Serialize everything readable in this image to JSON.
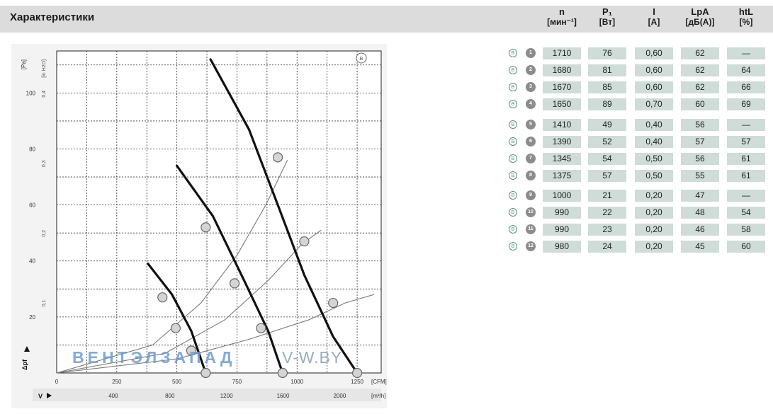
{
  "header": {
    "title": "Характеристики",
    "columns": [
      {
        "symbol": "n",
        "unit": "[мин⁻¹]"
      },
      {
        "symbol": "P₁",
        "unit": "[Вт]"
      },
      {
        "symbol": "I",
        "unit": "[A]"
      },
      {
        "symbol": "LpA",
        "unit": "[дБ(А)]"
      },
      {
        "symbol": "htL",
        "unit": "[%]"
      }
    ]
  },
  "table": {
    "badge_letter": "B",
    "rows": [
      {
        "id": "1",
        "n": "1710",
        "p1": "76",
        "i": "0,60",
        "lpa": "62",
        "htl": "—"
      },
      {
        "id": "2",
        "n": "1680",
        "p1": "81",
        "i": "0,60",
        "lpa": "62",
        "htl": "64"
      },
      {
        "id": "3",
        "n": "1670",
        "p1": "85",
        "i": "0,60",
        "lpa": "62",
        "htl": "66"
      },
      {
        "id": "4",
        "n": "1650",
        "p1": "89",
        "i": "0,70",
        "lpa": "60",
        "htl": "69"
      },
      {
        "id": "5",
        "n": "1410",
        "p1": "49",
        "i": "0,40",
        "lpa": "56",
        "htl": "—"
      },
      {
        "id": "6",
        "n": "1390",
        "p1": "52",
        "i": "0,40",
        "lpa": "57",
        "htl": "57"
      },
      {
        "id": "7",
        "n": "1345",
        "p1": "54",
        "i": "0,50",
        "lpa": "56",
        "htl": "61"
      },
      {
        "id": "8",
        "n": "1375",
        "p1": "57",
        "i": "0,50",
        "lpa": "55",
        "htl": "61"
      },
      {
        "id": "9",
        "n": "1000",
        "p1": "21",
        "i": "0,20",
        "lpa": "47",
        "htl": "—"
      },
      {
        "id": "10",
        "n": "990",
        "p1": "22",
        "i": "0,20",
        "lpa": "48",
        "htl": "54"
      },
      {
        "id": "11",
        "n": "990",
        "p1": "23",
        "i": "0,20",
        "lpa": "46",
        "htl": "58"
      },
      {
        "id": "12",
        "n": "980",
        "p1": "24",
        "i": "0,20",
        "lpa": "45",
        "htl": "60"
      }
    ]
  },
  "watermark": {
    "part1": "ВЕНТЭЛЗАПАД",
    "part2": "V-W.BY"
  },
  "chart_data": {
    "type": "line",
    "corner_badge": "B",
    "x_axis": {
      "unit": "[CFM]",
      "range": [
        0,
        1350
      ],
      "ticks": [
        "0",
        "250",
        "500",
        "750",
        "1000",
        "1250"
      ]
    },
    "x_axis_2": {
      "unit": "[m³/h]",
      "ticks": [
        "400",
        "800",
        "1200",
        "1600",
        "2000"
      ]
    },
    "y_axis": {
      "unit": "[Pa]",
      "range": [
        0,
        115
      ],
      "ticks": [
        "20",
        "40",
        "60",
        "80",
        "100"
      ]
    },
    "y_axis_2": {
      "unit": "[in H2O]",
      "ticks": [
        "0,1",
        "0,2",
        "0,3",
        "0,4"
      ]
    },
    "y_axis_label": "Δpf",
    "x_axis_label": "V",
    "grid": true,
    "series": [
      {
        "points": [
          [
            640,
            112
          ],
          [
            800,
            87
          ],
          [
            920,
            60
          ],
          [
            1030,
            35
          ],
          [
            1150,
            13
          ],
          [
            1250,
            0
          ]
        ]
      },
      {
        "points": [
          [
            500,
            74
          ],
          [
            650,
            56
          ],
          [
            780,
            33
          ],
          [
            880,
            15
          ],
          [
            940,
            0
          ]
        ]
      },
      {
        "points": [
          [
            380,
            39
          ],
          [
            480,
            28
          ],
          [
            560,
            15
          ],
          [
            620,
            0
          ]
        ]
      }
    ],
    "system_curves": [
      {
        "points": [
          [
            0,
            0
          ],
          [
            400,
            10
          ],
          [
            600,
            25
          ],
          [
            750,
            42
          ],
          [
            870,
            60
          ],
          [
            960,
            76
          ]
        ]
      },
      {
        "points": [
          [
            0,
            0
          ],
          [
            450,
            7
          ],
          [
            700,
            19
          ],
          [
            880,
            33
          ],
          [
            1020,
            46
          ],
          [
            1100,
            51
          ]
        ]
      },
      {
        "points": [
          [
            0,
            0
          ],
          [
            500,
            5
          ],
          [
            800,
            12
          ],
          [
            1050,
            19
          ],
          [
            1200,
            25
          ],
          [
            1320,
            28
          ]
        ]
      }
    ],
    "operating_points": [
      {
        "label": "1",
        "x": 1250,
        "y": 0
      },
      {
        "label": "2",
        "x": 1150,
        "y": 25
      },
      {
        "label": "3",
        "x": 1030,
        "y": 47
      },
      {
        "label": "4",
        "x": 920,
        "y": 77
      },
      {
        "label": "5",
        "x": 940,
        "y": 0
      },
      {
        "label": "6",
        "x": 850,
        "y": 16
      },
      {
        "label": "7",
        "x": 740,
        "y": 32
      },
      {
        "label": "8",
        "x": 620,
        "y": 52
      },
      {
        "label": "9",
        "x": 620,
        "y": 0
      },
      {
        "label": "10",
        "x": 560,
        "y": 8
      },
      {
        "label": "11",
        "x": 495,
        "y": 16
      },
      {
        "label": "12",
        "x": 440,
        "y": 27
      }
    ]
  },
  "colors": {
    "header_bg": "#dcdcdc",
    "cell_bg": "#cfdcd7",
    "badge": "#5a8f84",
    "watermark_1": "#6f9ccf",
    "watermark_2": "#8fa5b8"
  }
}
